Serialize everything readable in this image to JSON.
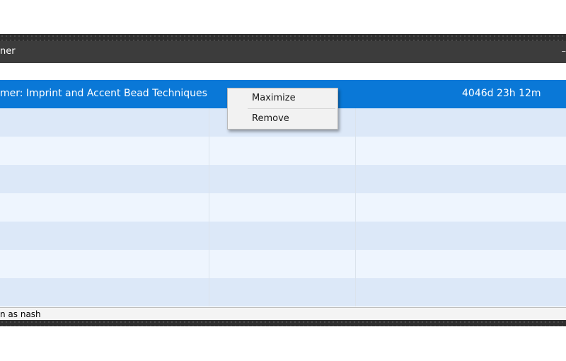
{
  "window": {
    "title_fragment": "ner",
    "control_fragment": "–"
  },
  "list": {
    "selected_item": {
      "name": "mer: Imprint and Accent Bead Techniques",
      "time_remaining": "4046d 23h 12m"
    },
    "empty_rows": 7
  },
  "statusbar": {
    "text": "n as nash"
  },
  "context_menu": {
    "items": [
      "Maximize",
      "Remove"
    ]
  },
  "colors": {
    "selection": "#0a78d7",
    "row_alt_1": "#dce8f8",
    "row_alt_2": "#eef5fe",
    "titlebar": "#3c3c3c"
  }
}
